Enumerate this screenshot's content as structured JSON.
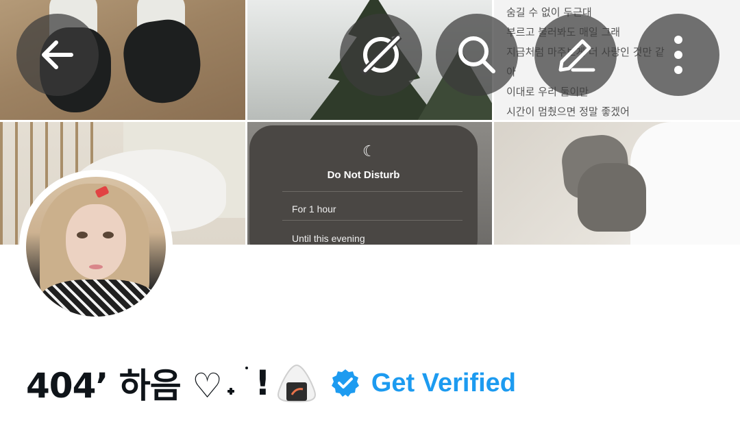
{
  "header": {
    "buttons": [
      {
        "name": "back-button",
        "icon": "arrow-left-icon"
      },
      {
        "name": "grok-button",
        "icon": "grok-icon"
      },
      {
        "name": "search-button",
        "icon": "search-icon"
      },
      {
        "name": "edit-button",
        "icon": "pencil-icon"
      },
      {
        "name": "more-options-button",
        "icon": "vertical-ellipsis-icon"
      }
    ]
  },
  "banner": {
    "lyrics": [
      "숨길 수 없이 두근대",
      "부르고 불러봐도 매일 그래",
      "지금처럼 마주보게 더 사랑인 것만 같",
      "아",
      "이대로 우리 둘이만",
      "시간이 멈췄으면 정말 좋겠어"
    ],
    "dnd_panel": {
      "title": "Do Not Disturb",
      "options": [
        "For 1 hour",
        "Until this evening"
      ]
    }
  },
  "profile": {
    "display_name": "404’ 하음 ♡",
    "display_name_end": "!",
    "emoji": "rice-ball-icon",
    "verified_badge_color": "#1d9bf0",
    "get_verified_label": "Get Verified"
  }
}
